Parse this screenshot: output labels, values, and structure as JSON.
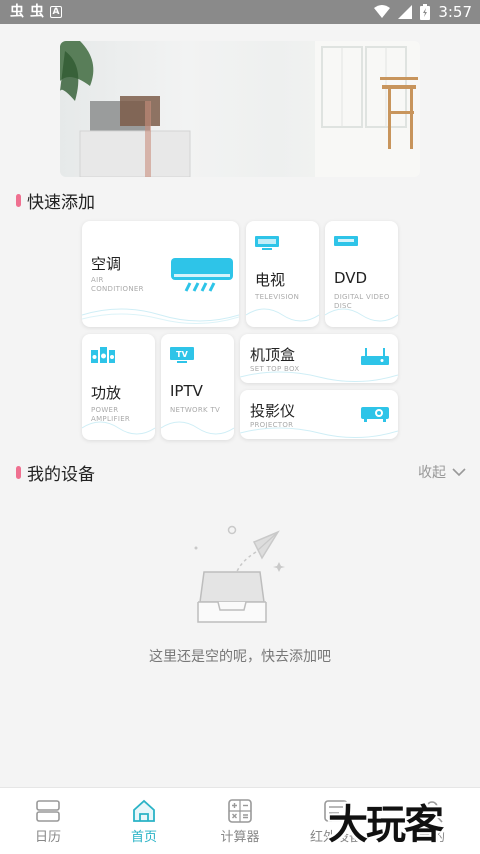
{
  "status_bar": {
    "left_icons": [
      "虫",
      "虫"
    ],
    "badge": "A",
    "time": "3:57"
  },
  "banner": {
    "image": "living-room-photo"
  },
  "quick_add": {
    "title": "快速添加",
    "devices": [
      {
        "name": "空调",
        "sub": "AIR\nCONDITIONER",
        "icon": "air-conditioner-icon"
      },
      {
        "name": "电视",
        "sub": "TELEVISION",
        "icon": "tv-icon"
      },
      {
        "name": "DVD",
        "sub": "DIGITAL VIDEO\nDISC",
        "icon": "dvd-icon"
      },
      {
        "name": "功放",
        "sub": "POWER\nAMPLIFIER",
        "icon": "amplifier-icon"
      },
      {
        "name": "IPTV",
        "sub": "NETWORK TV",
        "icon": "iptv-icon",
        "icon_text": "TV"
      },
      {
        "name": "机顶盒",
        "sub": "SET TOP BOX",
        "icon": "set-top-box-icon"
      },
      {
        "name": "投影仪",
        "sub": "PROJECTOR",
        "icon": "projector-icon"
      }
    ]
  },
  "my_devices": {
    "title": "我的设备",
    "collapse_label": "收起",
    "empty_text": "这里还是空的呢，快去添加吧"
  },
  "tabs": [
    {
      "label": "日历",
      "icon": "calendar-icon",
      "active": false
    },
    {
      "label": "首页",
      "icon": "home-icon",
      "active": true
    },
    {
      "label": "计算器",
      "icon": "calculator-icon",
      "active": false
    },
    {
      "label": "红外设备",
      "icon": "remote-icon",
      "active": false
    },
    {
      "label": "我的",
      "icon": "profile-icon",
      "active": false
    }
  ],
  "watermark": "大玩客",
  "colors": {
    "accent": "#2ab3c6",
    "icon_blue": "#2ec4e8",
    "section_marker": "#ef7090"
  }
}
